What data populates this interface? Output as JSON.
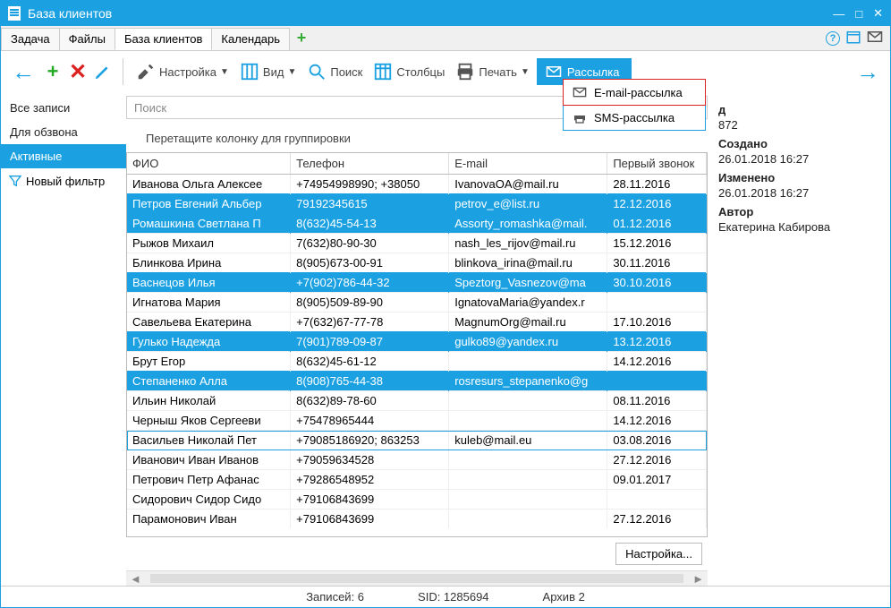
{
  "window": {
    "title": "База клиентов"
  },
  "tabs": [
    "Задача",
    "Файлы",
    "База клиентов",
    "Календарь"
  ],
  "active_tab": 2,
  "toolbar": {
    "settings": "Настройка",
    "view": "Вид",
    "search": "Поиск",
    "columns": "Столбцы",
    "print": "Печать",
    "mailing": "Рассылка"
  },
  "sidebar": {
    "items": [
      "Все записи",
      "Для обзвона",
      "Активные"
    ],
    "active": 2,
    "new_filter": "Новый фильтр"
  },
  "search_placeholder": "Поиск",
  "group_hint": "Перетащите колонку для группировки",
  "columns": {
    "fio": "ФИО",
    "tel": "Телефон",
    "email": "E-mail",
    "first_call": "Первый звонок"
  },
  "rows": [
    {
      "fio": "Иванова Ольга Алексее",
      "tel": "+74954998990; +38050",
      "email": "IvanovaOA@mail.ru",
      "call": "28.11.2016",
      "sel": false
    },
    {
      "fio": "Петров Евгений Альбер",
      "tel": "79192345615",
      "email": "petrov_e@list.ru",
      "call": "12.12.2016",
      "sel": true
    },
    {
      "fio": "Ромашкина Светлана П",
      "tel": "8(632)45-54-13",
      "email": "Assorty_romashka@mail.",
      "call": "01.12.2016",
      "sel": true
    },
    {
      "fio": "Рыжов Михаил",
      "tel": "7(632)80-90-30",
      "email": "nash_les_rijov@mail.ru",
      "call": "15.12.2016",
      "sel": false
    },
    {
      "fio": "Блинкова Ирина",
      "tel": "8(905)673-00-91",
      "email": "blinkova_irina@mail.ru",
      "call": "30.11.2016",
      "sel": false
    },
    {
      "fio": "Васнецов Илья",
      "tel": "+7(902)786-44-32",
      "email": "Speztorg_Vasnezov@ma",
      "call": "30.10.2016",
      "sel": true
    },
    {
      "fio": "Игнатова Мария",
      "tel": "8(905)509-89-90",
      "email": "IgnatovaMaria@yandex.r",
      "call": "",
      "sel": false
    },
    {
      "fio": "Савельева Екатерина",
      "tel": "+7(632)67-77-78",
      "email": "MagnumOrg@mail.ru",
      "call": "17.10.2016",
      "sel": false
    },
    {
      "fio": "Гулько Надежда",
      "tel": "7(901)789-09-87",
      "email": "gulko89@yandex.ru",
      "call": "13.12.2016",
      "sel": true
    },
    {
      "fio": "Брут Егор",
      "tel": "8(632)45-61-12",
      "email": "",
      "call": "14.12.2016",
      "sel": false
    },
    {
      "fio": "Степаненко Алла",
      "tel": "8(908)765-44-38",
      "email": "rosresurs_stepanenko@g",
      "call": "",
      "sel": true
    },
    {
      "fio": "Ильин Николай",
      "tel": "8(632)89-78-60",
      "email": "",
      "call": "08.11.2016",
      "sel": false
    },
    {
      "fio": "Черныш Яков Сергееви",
      "tel": "+75478965444",
      "email": "",
      "call": "14.12.2016",
      "sel": false
    },
    {
      "fio": "Васильев  Николай Пет",
      "tel": "+79085186920; 863253",
      "email": "kuleb@mail.eu",
      "call": "03.08.2016",
      "sel": false,
      "focus": true
    },
    {
      "fio": "Иванович Иван Иванов",
      "tel": "+79059634528",
      "email": "",
      "call": "27.12.2016",
      "sel": false
    },
    {
      "fio": "Петрович Петр Афанас",
      "tel": "+79286548952",
      "email": "",
      "call": "09.01.2017",
      "sel": false
    },
    {
      "fio": "Сидорович Сидор Сидо",
      "tel": "+79106843699",
      "email": "",
      "call": "",
      "sel": false
    },
    {
      "fio": "Парамонович Иван",
      "tel": "+79106843699",
      "email": "",
      "call": "27.12.2016",
      "sel": false
    }
  ],
  "grid_settings_btn": "Настройка...",
  "dropdown": {
    "email": "E-mail-рассылка",
    "sms": "SMS-рассылка"
  },
  "details": {
    "code_label": "д",
    "code_value": "872",
    "created_label": "Создано",
    "created_value": "26.01.2018 16:27",
    "changed_label": "Изменено",
    "changed_value": "26.01.2018 16:27",
    "author_label": "Автор",
    "author_value": "Екатерина Кабирова"
  },
  "status": {
    "records": "Записей: 6",
    "sid": "SID: 1285694",
    "archive": "Архив 2"
  }
}
